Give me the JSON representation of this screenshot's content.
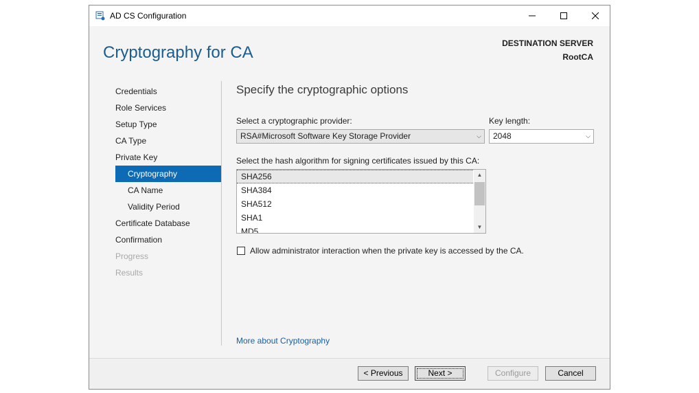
{
  "window": {
    "title": "AD CS Configuration"
  },
  "header": {
    "title": "Cryptography for CA",
    "destination_label": "DESTINATION SERVER",
    "destination_value": "RootCA"
  },
  "nav": {
    "items": [
      {
        "label": "Credentials",
        "state": "normal"
      },
      {
        "label": "Role Services",
        "state": "normal"
      },
      {
        "label": "Setup Type",
        "state": "normal"
      },
      {
        "label": "CA Type",
        "state": "normal"
      },
      {
        "label": "Private Key",
        "state": "normal"
      },
      {
        "label": "Cryptography",
        "state": "selected"
      },
      {
        "label": "CA Name",
        "state": "normal"
      },
      {
        "label": "Validity Period",
        "state": "normal"
      },
      {
        "label": "Certificate Database",
        "state": "normal"
      },
      {
        "label": "Confirmation",
        "state": "normal"
      },
      {
        "label": "Progress",
        "state": "disabled"
      },
      {
        "label": "Results",
        "state": "disabled"
      }
    ]
  },
  "main": {
    "section_title": "Specify the cryptographic options",
    "provider_label": "Select a cryptographic provider:",
    "provider_value": "RSA#Microsoft Software Key Storage Provider",
    "key_length_label": "Key length:",
    "key_length_value": "2048",
    "hash_label": "Select the hash algorithm for signing certificates issued by this CA:",
    "hash_options": [
      "SHA256",
      "SHA384",
      "SHA512",
      "SHA1",
      "MD5"
    ],
    "hash_selected": "SHA256",
    "checkbox_label": "Allow administrator interaction when the private key is accessed by the CA.",
    "checkbox_checked": false,
    "link": "More about Cryptography"
  },
  "footer": {
    "previous": "< Previous",
    "next": "Next >",
    "configure": "Configure",
    "cancel": "Cancel"
  },
  "colors": {
    "accent": "#0d6bb5",
    "title": "#1a5d8e",
    "link": "#1a5d9e"
  }
}
